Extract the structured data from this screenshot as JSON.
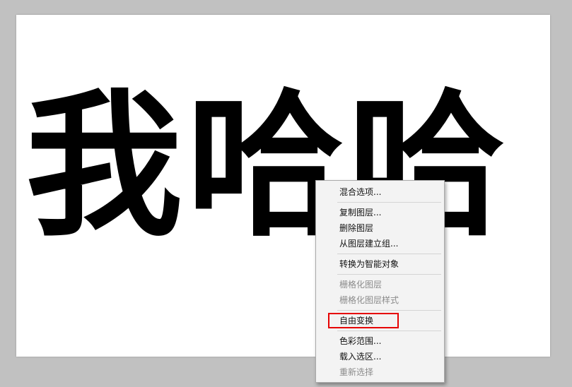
{
  "canvas": {
    "text": "我哈哈"
  },
  "context_menu": {
    "items": [
      {
        "label": "混合选项...",
        "enabled": true
      },
      {
        "label": "复制图层...",
        "enabled": true
      },
      {
        "label": "删除图层",
        "enabled": true
      },
      {
        "label": "从图层建立组...",
        "enabled": true
      },
      {
        "label": "转换为智能对象",
        "enabled": true
      },
      {
        "label": "栅格化图层",
        "enabled": false
      },
      {
        "label": "栅格化图层样式",
        "enabled": false
      },
      {
        "label": "自由变换",
        "enabled": true,
        "highlighted": true,
        "highlight_color": "#e60000"
      },
      {
        "label": "色彩范围...",
        "enabled": true
      },
      {
        "label": "载入选区...",
        "enabled": true
      },
      {
        "label": "重新选择",
        "enabled": false
      }
    ]
  }
}
